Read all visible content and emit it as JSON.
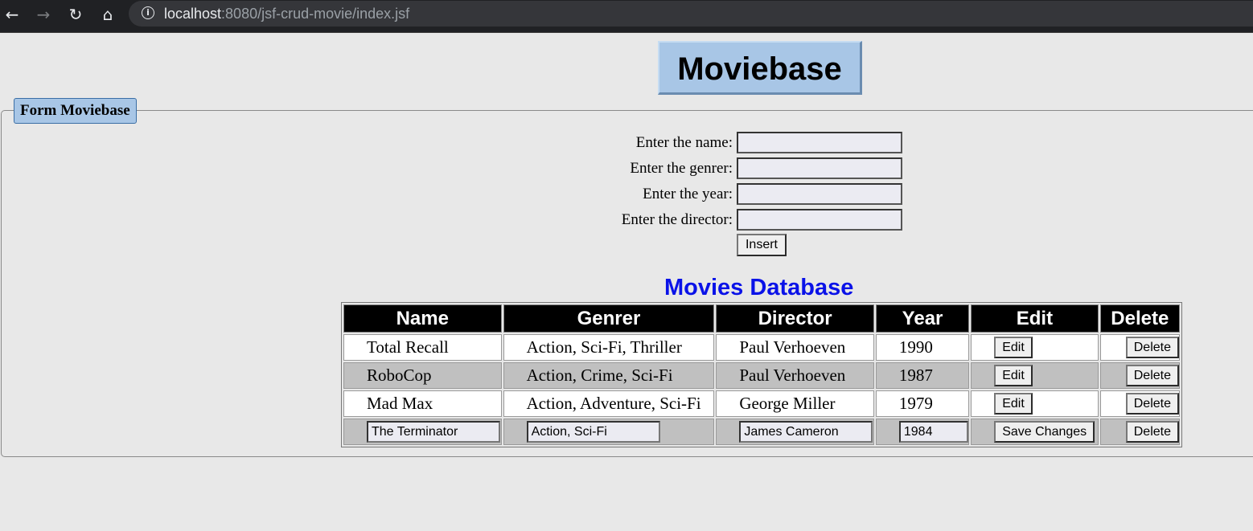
{
  "browser": {
    "url_host": "localhost",
    "url_rest": ":8080/jsf-crud-movie/index.jsf"
  },
  "page": {
    "title": "Moviebase",
    "fieldset_legend": "Form Moviebase"
  },
  "form": {
    "name_label": "Enter the name:",
    "genre_label": "Enter the genrer:",
    "year_label": "Enter the year:",
    "director_label": "Enter the director:",
    "insert_label": "Insert"
  },
  "table": {
    "title": "Movies Database",
    "headers": [
      "Name",
      "Genrer",
      "Director",
      "Year",
      "Edit",
      "Delete"
    ],
    "edit_label": "Edit",
    "delete_label": "Delete",
    "save_label": "Save Changes",
    "rows": [
      {
        "name": "Total Recall",
        "genre": "Action, Sci-Fi, Thriller",
        "director": "Paul Verhoeven",
        "year": "1990"
      },
      {
        "name": "RoboCop",
        "genre": "Action, Crime, Sci-Fi",
        "director": "Paul Verhoeven",
        "year": "1987"
      },
      {
        "name": "Mad Max",
        "genre": "Action, Adventure, Sci-Fi",
        "director": "George Miller",
        "year": "1979"
      },
      {
        "name": "The Terminator",
        "genre": "Action, Sci-Fi",
        "director": "James Cameron",
        "year": "1984"
      }
    ]
  }
}
